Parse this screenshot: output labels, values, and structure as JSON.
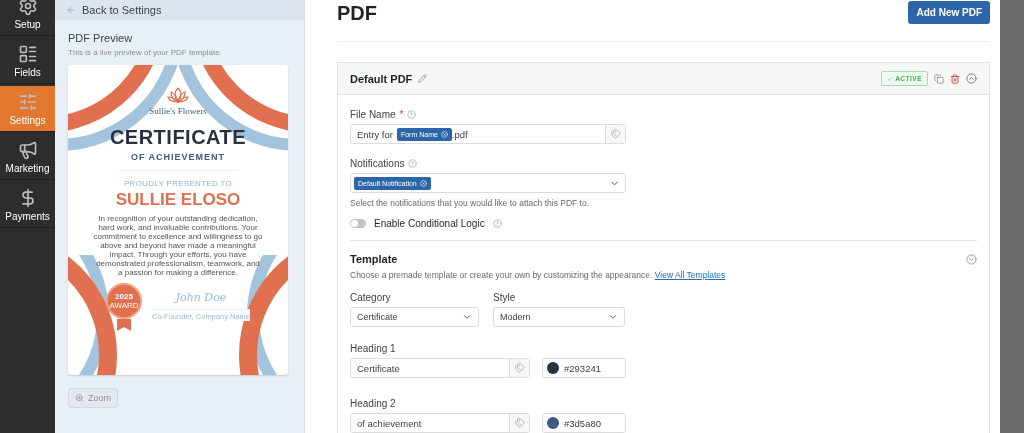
{
  "sidebar": {
    "items": [
      {
        "label": "Setup",
        "selected": false
      },
      {
        "label": "Fields",
        "selected": false
      },
      {
        "label": "Settings",
        "selected": true
      },
      {
        "label": "Marketing",
        "selected": false
      },
      {
        "label": "Payments",
        "selected": false
      }
    ]
  },
  "preview_panel": {
    "back_link": "Back to Settings",
    "title": "PDF Preview",
    "description": "This is a live preview of your PDF template.",
    "certificate": {
      "brand": "Sullie's Flowers",
      "heading_1": "CERTIFICATE",
      "heading_2": "OF ACHIEVEMENT",
      "presented_label": "PROUDLY PRESENTED TO",
      "recipient": "SULLIE ELOSO",
      "body": "In recognition of your outstanding dedication, hard work, and invaluable contributions. Your commitment to excellence and willingness to go above and beyond have made a meaningful impact. Through your efforts, you have demonstrated professionalism, teamwork, and a passion for making a difference.",
      "badge_year": "2025",
      "badge_label": "AWARD",
      "signature": "John Doe",
      "signer_title": "Co-Founder, Company Name"
    },
    "zoom_button": "Zoom"
  },
  "page": {
    "title": "PDF",
    "add_button": "Add New PDF"
  },
  "pdf_card": {
    "title": "Default PDF",
    "status": "ACTIVE",
    "file_name": {
      "label": "File Name",
      "required_mark": "*",
      "prefix": "Entry for",
      "tag": "Form Name",
      "suffix": ".pdf"
    },
    "notifications": {
      "label": "Notifications",
      "tags": [
        "Default Notification"
      ],
      "help": "Select the notifications that you would like to attach this PDF to."
    },
    "conditional_logic": {
      "label": "Enable Conditional Logic",
      "on": false
    },
    "template": {
      "title": "Template",
      "description": "Choose a premade template or create your own by customizing the appearance.",
      "link": "View All Templates",
      "category": {
        "label": "Category",
        "value": "Certificate"
      },
      "style": {
        "label": "Style",
        "value": "Modern"
      },
      "headings": [
        {
          "label": "Heading 1",
          "value": "Certificate",
          "color": "#293241",
          "color_text": "#293241"
        },
        {
          "label": "Heading 2",
          "value": "of achievement",
          "color": "#3d5a80",
          "color_text": "#3d5a80"
        }
      ]
    }
  }
}
